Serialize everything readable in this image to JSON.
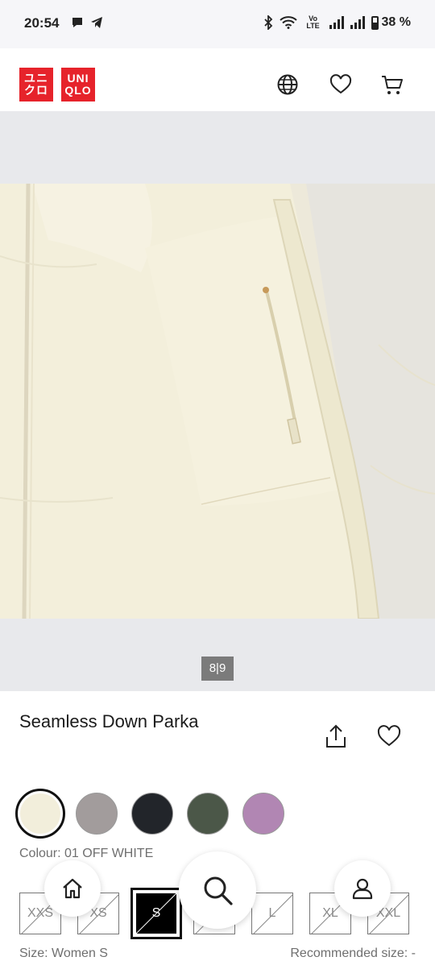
{
  "status_bar": {
    "time": "20:54",
    "volte": "Vo LTE",
    "battery": "38 %"
  },
  "header": {
    "logo_top": "ユニ クロ",
    "logo_top_line1": "ユニ",
    "logo_top_line2": "クロ",
    "logo_right_line1": "UNI",
    "logo_right_line2": "QLO",
    "brand_color": "#e6232b",
    "icons": [
      "globe-icon",
      "heart-icon",
      "cart-icon"
    ]
  },
  "gallery": {
    "counter": "8|9",
    "image_alt": "cream colored puffer jacket close-up",
    "background": "#e8e9ec"
  },
  "product": {
    "title": "Seamless Down Parka"
  },
  "colours": {
    "swatches": [
      {
        "name": "01 OFF WHITE",
        "hex": "#f2eedb",
        "selected": true
      },
      {
        "name": "grey",
        "hex": "#a29c9c",
        "selected": false
      },
      {
        "name": "black",
        "hex": "#22252a",
        "selected": false
      },
      {
        "name": "olive",
        "hex": "#4b5748",
        "selected": false
      },
      {
        "name": "purple",
        "hex": "#b186b3",
        "selected": false
      }
    ],
    "label": "Colour: 01 OFF WHITE"
  },
  "sizes": {
    "options": [
      {
        "label": "XXS",
        "available": false
      },
      {
        "label": "XS",
        "available": false
      },
      {
        "label": "S",
        "available": false,
        "selected": true
      },
      {
        "label": "M",
        "available": false
      },
      {
        "label": "L",
        "available": false
      },
      {
        "label": "XL",
        "available": false
      },
      {
        "label": "XXL",
        "available": false
      }
    ],
    "size_label": "Size: Women S",
    "recommended_label": "Recommended size: -"
  },
  "bottom_nav": [
    "home-icon",
    "search-icon",
    "account-icon"
  ]
}
